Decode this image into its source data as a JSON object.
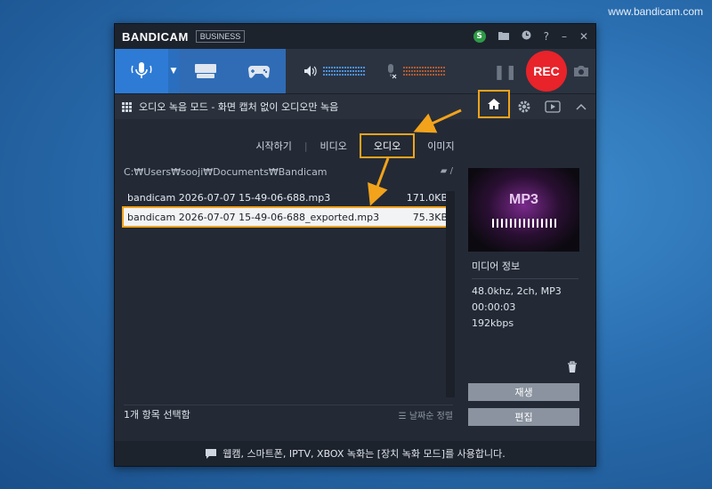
{
  "watermark": "www.bandicam.com",
  "title": {
    "logo_a": "BANDI",
    "logo_b": "CAM",
    "edition": "BUSINESS",
    "badge": "S"
  },
  "toolbar": {
    "rec_label": "REC"
  },
  "modebar": {
    "label": "오디오 녹음 모드 - 화면 캡처 없이 오디오만 녹음"
  },
  "tabs": [
    {
      "label": "시작하기"
    },
    {
      "label": "비디오"
    },
    {
      "label": "오디오"
    },
    {
      "label": "이미지"
    }
  ],
  "path": "C:₩Users₩sooji₩Documents₩Bandicam",
  "files": [
    {
      "name": "bandicam 2026-07-07 15-49-06-688.mp3",
      "size": "171.0KB"
    },
    {
      "name": "bandicam 2026-07-07 15-49-06-688_exported.mp3",
      "size": "75.3KB"
    }
  ],
  "status": {
    "selected": "1개 항목 선택함",
    "sort": "날짜순 정렬"
  },
  "preview": {
    "format": "MP3"
  },
  "media_info": {
    "title": "미디어 정보",
    "line1": "48.0khz, 2ch, MP3",
    "line2": "00:00:03",
    "line3": "192kbps"
  },
  "buttons": {
    "play": "재생",
    "edit": "편집"
  },
  "footer": {
    "text": "웹캠, 스마트폰, IPTV, XBOX 녹화는 [장치 녹화 모드]를 사용합니다."
  },
  "colors": {
    "accent": "#f2a31b",
    "rec": "#e8232a",
    "active_mode": "#2e7bd6"
  }
}
